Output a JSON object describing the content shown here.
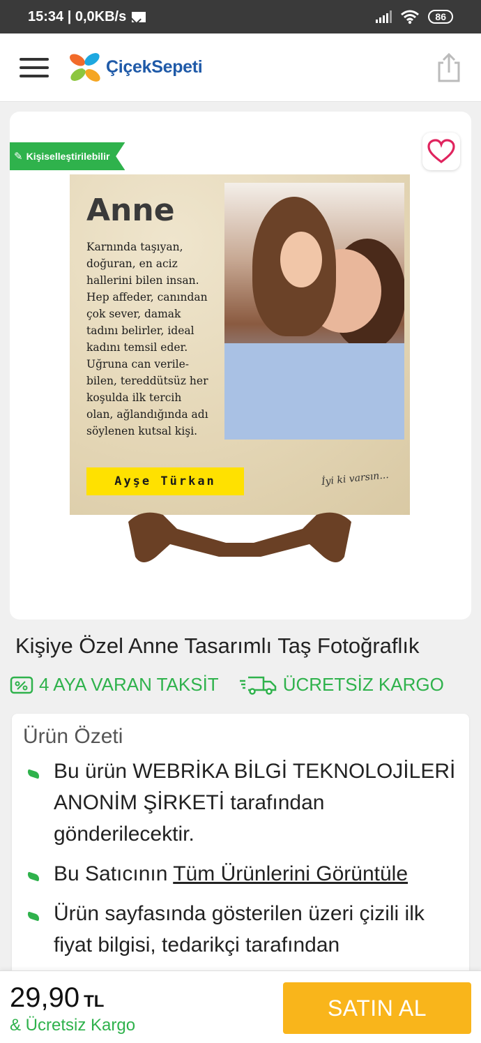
{
  "status_bar": {
    "time": "15:34 | 0,0KB/s",
    "battery": "86"
  },
  "header": {
    "logo_text": "ÇiçekSepeti"
  },
  "product": {
    "badge": "Kişiselleştirilebilir",
    "image": {
      "heading": "Anne",
      "poem_lines": [
        "Karnında taşıyan,",
        "doğuran, en aciz",
        "hallerini bilen insan.",
        "Hep affeder, canından",
        "çok sever, damak",
        "tadını belirler, ideal",
        "kadını temsil eder.",
        "Uğruna can verile-",
        "bilen, tereddütsüz her",
        "koşulda ilk tercih",
        "olan, ağlandığında adı",
        "söylenen kutsal kişi."
      ],
      "name_tag": "Ayşe Türkan",
      "signature": "İyi ki varsın..."
    },
    "title": "Kişiye Özel Anne Tasarımlı Taş Fotoğraflık",
    "perks": {
      "installment": "4 AYA VARAN TAKSİT",
      "shipping": "ÜCRETSİZ KARGO"
    }
  },
  "summary": {
    "title": "Ürün Özeti",
    "item1": "Bu ürün WEBRİKA BİLGİ TEKNOLOJİLERİ ANONİM ŞİRKETİ tarafından gönderilecektir.",
    "item2_prefix": "Bu Satıcının ",
    "item2_link": "Tüm Ürünlerini Görüntüle",
    "item3": "Ürün sayfasında gösterilen üzeri çizili ilk fiyat bilgisi, tedarikçi tarafından"
  },
  "bottom_bar": {
    "price": "29,90",
    "currency": "TL",
    "shipping": "& Ücretsiz Kargo",
    "buy_label": "SATIN AL"
  },
  "colors": {
    "brand_green": "#2fb24c",
    "buy_button": "#f9b51b",
    "logo_blue": "#1f5aa8",
    "favorite_heart": "#e0245e"
  }
}
